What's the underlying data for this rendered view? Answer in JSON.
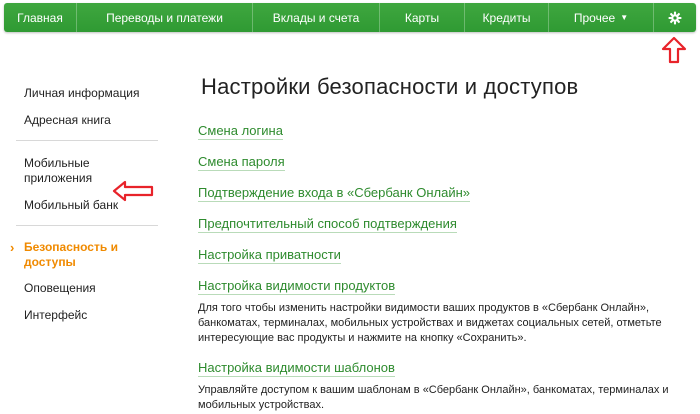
{
  "topnav": {
    "items": [
      "Главная",
      "Переводы и платежи",
      "Вклады и счета",
      "Карты",
      "Кредиты",
      "Прочее"
    ],
    "more_caret": "▼",
    "settings_icon": "gear-icon"
  },
  "sidebar": {
    "items": [
      "Личная информация",
      "Адресная книга",
      "Мобильные приложения",
      "Мобильный банк",
      "Безопасность и доступы",
      "Оповещения",
      "Интерфейс"
    ],
    "active_marker": "›"
  },
  "main": {
    "title": "Настройки безопасности и доступов",
    "links": [
      "Смена логина",
      "Смена пароля",
      "Подтверждение входа в «Сбербанк Онлайн»",
      "Предпочтительный способ подтверждения",
      "Настройка приватности",
      "Настройка видимости продуктов",
      "Настройка видимости шаблонов"
    ],
    "product_visibility_desc": "Для того чтобы изменить настройки видимости ваших продуктов в «Сбербанк Онлайн», банкоматах, терминалах, мобильных устройствах и виджетах социальных сетей, отметьте интересующие вас продукты и нажмите на кнопку «Сохранить».",
    "template_visibility_desc": "Управляйте доступом к вашим шаблонам в «Сбербанк Онлайн», банкоматах, терминалах и мобильных устройствах."
  },
  "colors": {
    "nav_green": "#2f9a33",
    "link_green": "#2e8b2e",
    "active_orange": "#f08a00",
    "annotation_red": "#e8232a"
  }
}
